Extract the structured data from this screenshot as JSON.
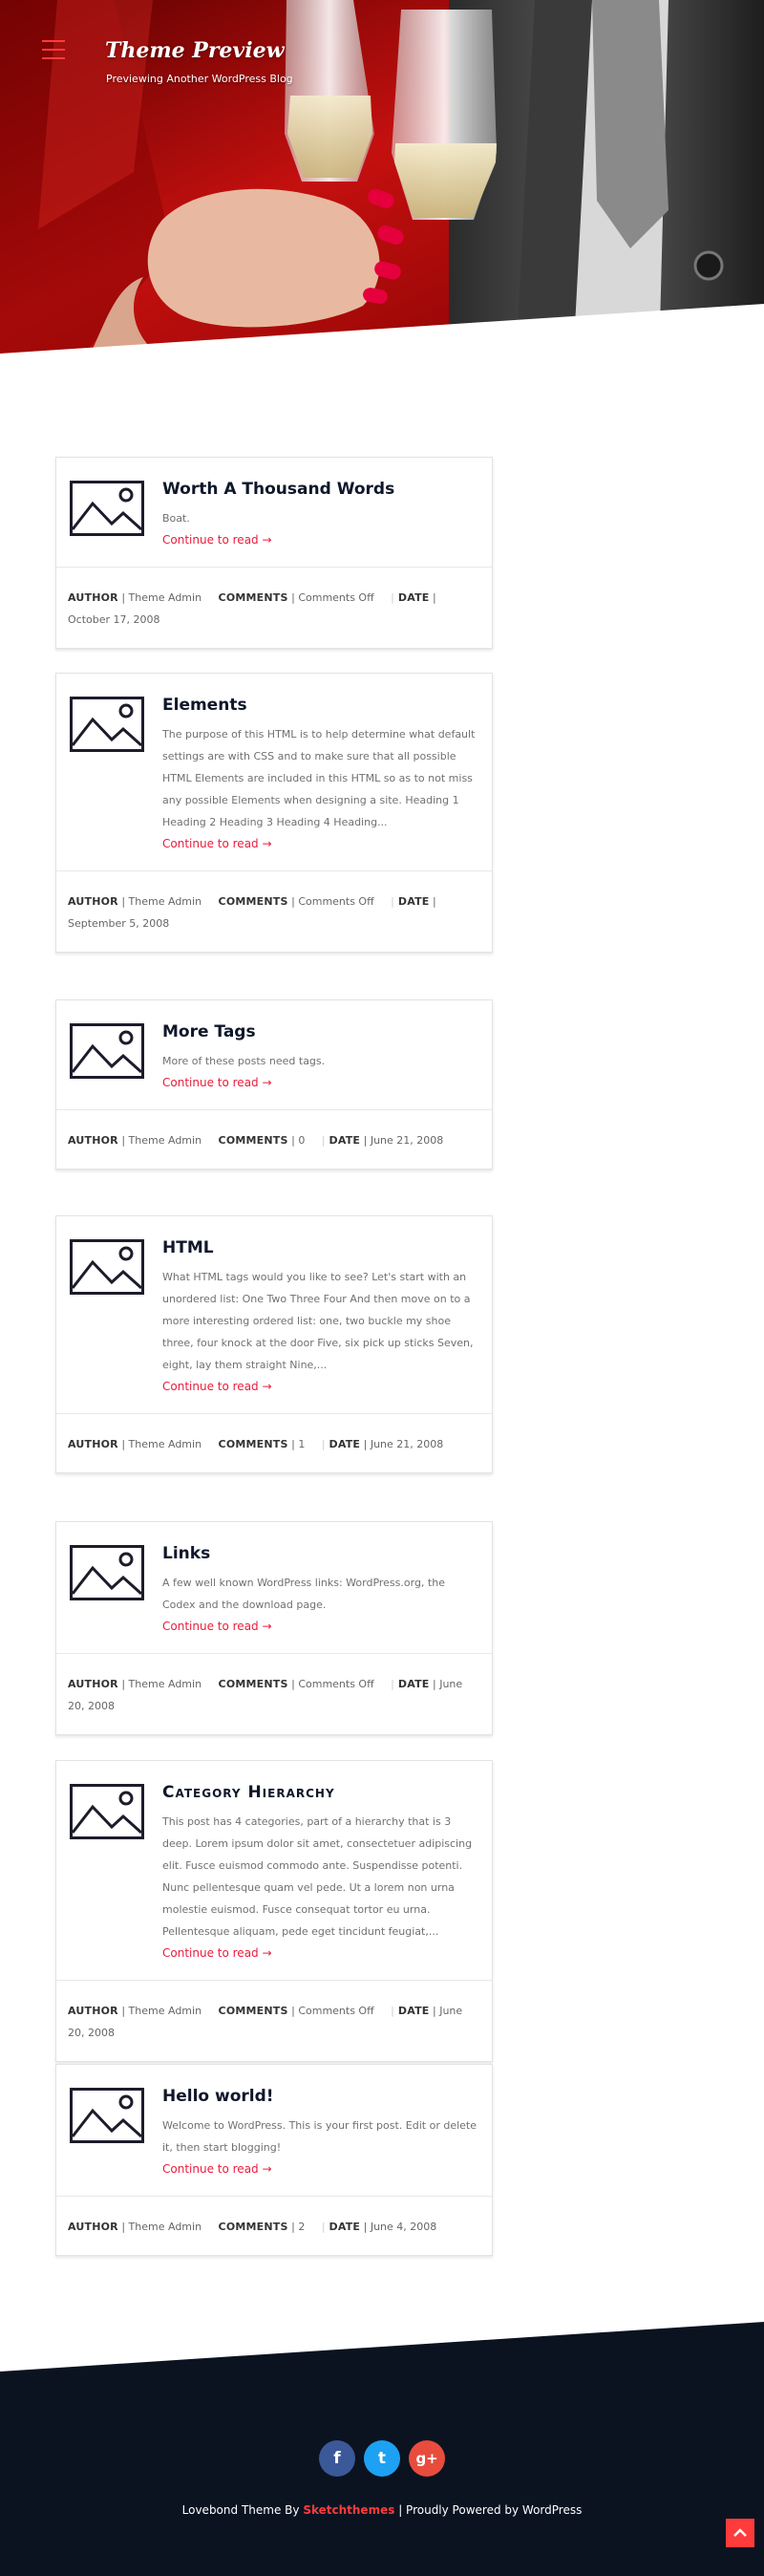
{
  "site": {
    "title": "Theme Preview",
    "tagline": "Previewing Another WordPress Blog"
  },
  "meta_labels": {
    "author": "AUTHOR",
    "comments": "COMMENTS",
    "date": "DATE"
  },
  "read_more_label": "Continue to read",
  "posts": [
    {
      "title": "Worth A Thousand Words",
      "excerpt": "Boat.",
      "read_more": "Continue to read →",
      "author": "Theme Admin",
      "comments": "Comments Off",
      "date": "October 17, 2008"
    },
    {
      "title": "Elements",
      "excerpt": "The purpose of this HTML is to help determine what default settings are with CSS and to make sure that all possible HTML Elements are included in this HTML so as to not miss any possible Elements when designing a site. Heading 1 Heading 2 Heading 3 Heading 4 Heading...",
      "read_more": "Continue to read →",
      "author": "Theme Admin",
      "comments": "Comments Off",
      "date": "September 5, 2008"
    },
    {
      "title": "More Tags",
      "excerpt": "More of these posts need tags.",
      "read_more": "Continue to read →",
      "author": "Theme Admin",
      "comments": "0",
      "date": "June 21, 2008"
    },
    {
      "title": "HTML",
      "excerpt": "What HTML tags would you like to see? Let's start with an unordered list: One Two Three Four And then move on to a more interesting ordered list: one, two buckle my shoe three, four knock at the door Five, six pick up sticks Seven, eight, lay them straight Nine,...",
      "read_more": "Continue to read →",
      "author": "Theme Admin",
      "comments": "1",
      "date": "June 21, 2008"
    },
    {
      "title": "Links",
      "excerpt": "A few well known WordPress links: WordPress.org, the Codex and the download page.",
      "read_more": "Continue to read →",
      "author": "Theme Admin",
      "comments": "Comments Off",
      "date": "June 20, 2008"
    },
    {
      "title": "Category Hierarchy",
      "excerpt": "This post has 4 categories, part of a hierarchy that is 3 deep. Lorem ipsum dolor sit amet, consectetuer adipiscing elit. Fusce euismod commodo ante. Suspendisse potenti. Nunc pellentesque quam vel pede. Ut a lorem non urna molestie euismod. Fusce consequat tortor eu urna. Pellentesque aliquam, pede eget tincidunt feugiat,...",
      "read_more": "Continue to read →",
      "author": "Theme Admin",
      "comments": "Comments Off",
      "date": "June 20, 2008"
    },
    {
      "title": "Hello world!",
      "excerpt": "Welcome to WordPress. This is your first post. Edit or delete it, then start blogging!",
      "read_more": "Continue to read →",
      "author": "Theme Admin",
      "comments": "2",
      "date": "June 4, 2008"
    }
  ],
  "footer": {
    "credit_prefix": "Lovebond Theme By",
    "credit_brand": "Sketchthemes",
    "credit_suffix": "| Proudly Powered by WordPress",
    "social": {
      "facebook_glyph": "f",
      "twitter_glyph": "t",
      "google_plus_glyph": "g+"
    }
  },
  "colors": {
    "accent": "#ea1c3c",
    "footer_bg": "#0b1321",
    "facebook": "#3b5998",
    "twitter": "#1da1f2",
    "google_plus": "#e84c3d"
  },
  "icons": {
    "menu": "hamburger-menu-icon",
    "thumbnail": "image-placeholder-icon",
    "read_more": "arrow-right-icon",
    "back_to_top": "chevron-up-icon"
  }
}
